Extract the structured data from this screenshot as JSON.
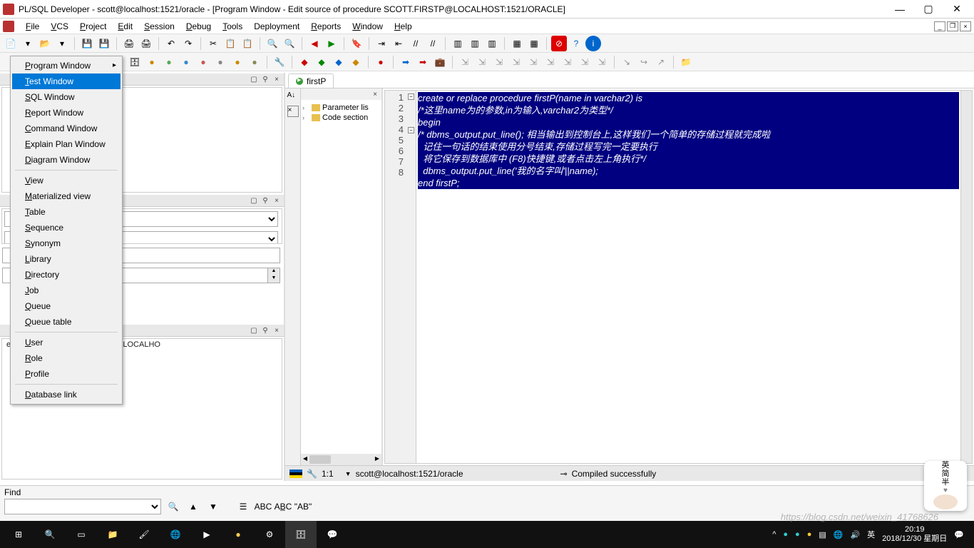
{
  "title": "PL/SQL Developer - scott@localhost:1521/oracle - [Program Window - Edit source of procedure SCOTT.FIRSTP@LOCALHOST:1521/ORACLE]",
  "menu": [
    "File",
    "VCS",
    "Project",
    "Edit",
    "Session",
    "Debug",
    "Tools",
    "Deployment",
    "Reports",
    "Window",
    "Help"
  ],
  "context": {
    "items": [
      {
        "label": "Program Window",
        "arrow": true
      },
      {
        "label": "Test Window",
        "hl": true
      },
      {
        "label": "SQL Window"
      },
      {
        "label": "Report Window"
      },
      {
        "label": "Command Window"
      },
      {
        "label": "Explain Plan Window"
      },
      {
        "label": "Diagram Window"
      },
      {
        "sep": true
      },
      {
        "label": "View"
      },
      {
        "label": "Materialized view"
      },
      {
        "label": "Table"
      },
      {
        "label": "Sequence"
      },
      {
        "label": "Synonym"
      },
      {
        "label": "Library"
      },
      {
        "label": "Directory"
      },
      {
        "label": "Job"
      },
      {
        "label": "Queue"
      },
      {
        "label": "Queue table"
      },
      {
        "sep": true
      },
      {
        "label": "User"
      },
      {
        "label": "Role"
      },
      {
        "label": "Profile"
      },
      {
        "sep": true
      },
      {
        "label": "Database link"
      }
    ]
  },
  "tab": "firstP",
  "outline": [
    "Parameter lis",
    "Code section"
  ],
  "code_lines": [
    "create or replace procedure firstP(name in varchar2) is",
    "/*这里name为的参数,in为输入,varchar2为类型*/",
    "begin",
    "/* dbms_output.put_line(); 相当输出到控制台上,这样我们一个简单的存储过程就完成啦",
    "  记住一句话的结束使用分号结束,存储过程写完一定要执行",
    "  将它保存到数据库中 (F8)快捷键,或者点击左上角执行*/",
    "  dbms_output.put_line('我的名字叫'||name);",
    "end firstP;"
  ],
  "left_status": "e of procedure SCOTT.FIRSTP@LOCALHO",
  "editor_status": {
    "pos": "1:1",
    "conn": "scott@localhost:1521/oracle",
    "compile": "Compiled successfully"
  },
  "find_label": "Find",
  "search_placeholders": {
    "abc": "ABC",
    "abcu": "AB̲C",
    "ab": "\"AB\""
  },
  "clock": {
    "time": "20:19",
    "date": "2018/12/30 星期日"
  },
  "floater": {
    "lines": [
      "英",
      "简",
      "半"
    ],
    "heart": "♥"
  },
  "watermark": "https://blog.csdn.net/weixin_41768626"
}
